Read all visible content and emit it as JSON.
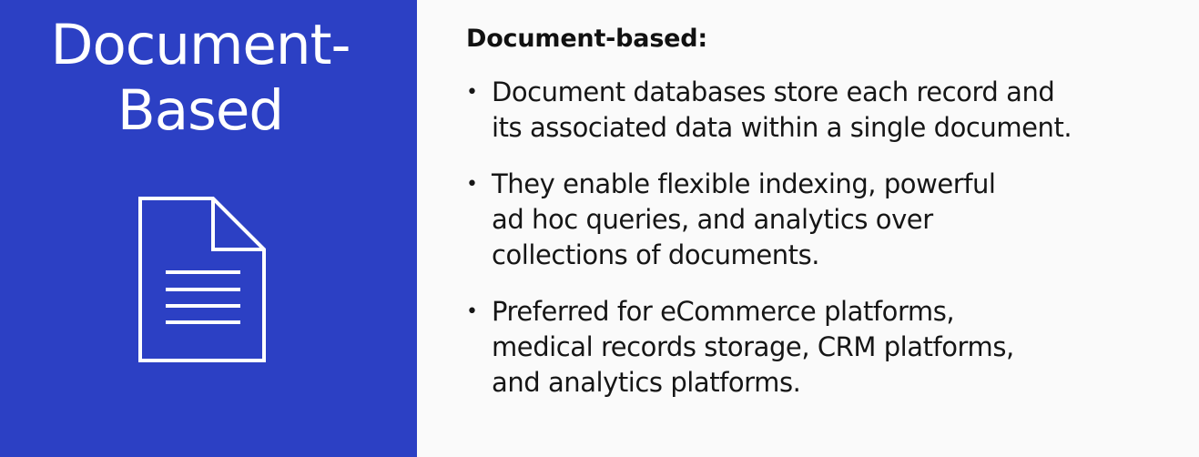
{
  "slide": {
    "left_title": "Document-\nBased",
    "left_icon": "document-icon",
    "heading": "Document-based:",
    "bullets": [
      "Document databases store each record and\nits associated data within a single document.",
      "They enable flexible indexing, powerful\nad hoc queries, and analytics over\ncollections of documents.",
      "Preferred for eCommerce platforms,\nmedical records storage, CRM platforms,\nand analytics platforms."
    ]
  },
  "colors": {
    "left_panel": "#2c40c4",
    "right_panel": "#fafafa",
    "text": "#161616",
    "title": "#ffffff"
  }
}
